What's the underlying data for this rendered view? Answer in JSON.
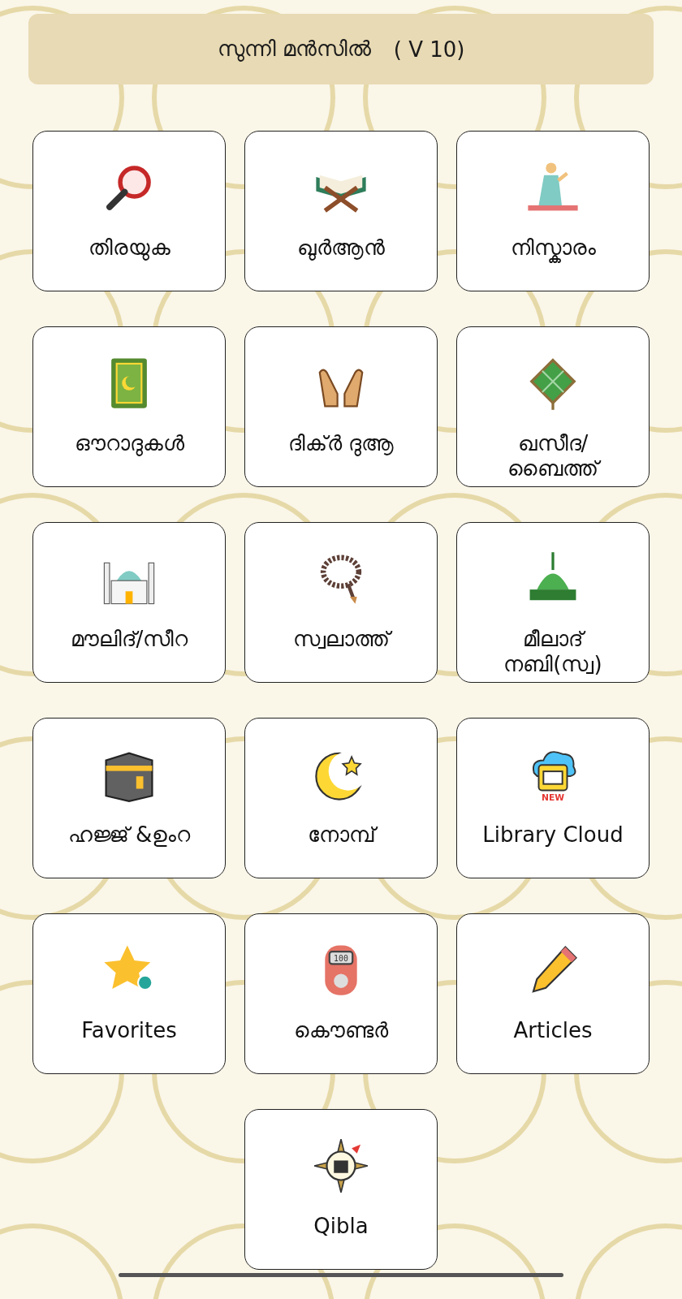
{
  "header": {
    "title": "സുന്നി മൻസിൽ",
    "version": "( V 10)"
  },
  "tiles": [
    {
      "kind": "search",
      "label": "തിരയുക"
    },
    {
      "kind": "quran",
      "label": "ഖുർആൻ"
    },
    {
      "kind": "prayer",
      "label": "നിസ്കാരം"
    },
    {
      "kind": "book",
      "label": "ഔറാദുകൾ"
    },
    {
      "kind": "hands",
      "label": "ദിക്ർ ദുആ"
    },
    {
      "kind": "ketupat",
      "label": "ഖസീദ/\nബൈത്ത്"
    },
    {
      "kind": "mosque",
      "label": "മൗലിദ്/സീറ"
    },
    {
      "kind": "beads",
      "label": "സ്വലാത്ത്"
    },
    {
      "kind": "dome",
      "label": "മീലാദ്\nനബി(സ്വ)"
    },
    {
      "kind": "kaaba",
      "label": "ഹജ്ജ് &ഉംറ"
    },
    {
      "kind": "crescent",
      "label": "നോമ്പ്"
    },
    {
      "kind": "cloud",
      "label": "Library Cloud",
      "badge": "NEW"
    },
    {
      "kind": "star",
      "label": "Favorites"
    },
    {
      "kind": "counter",
      "label": "കൌണ്ടർ",
      "display": "100"
    },
    {
      "kind": "pencil",
      "label": "Articles"
    },
    {
      "kind": "compass",
      "label": "Qibla"
    }
  ]
}
